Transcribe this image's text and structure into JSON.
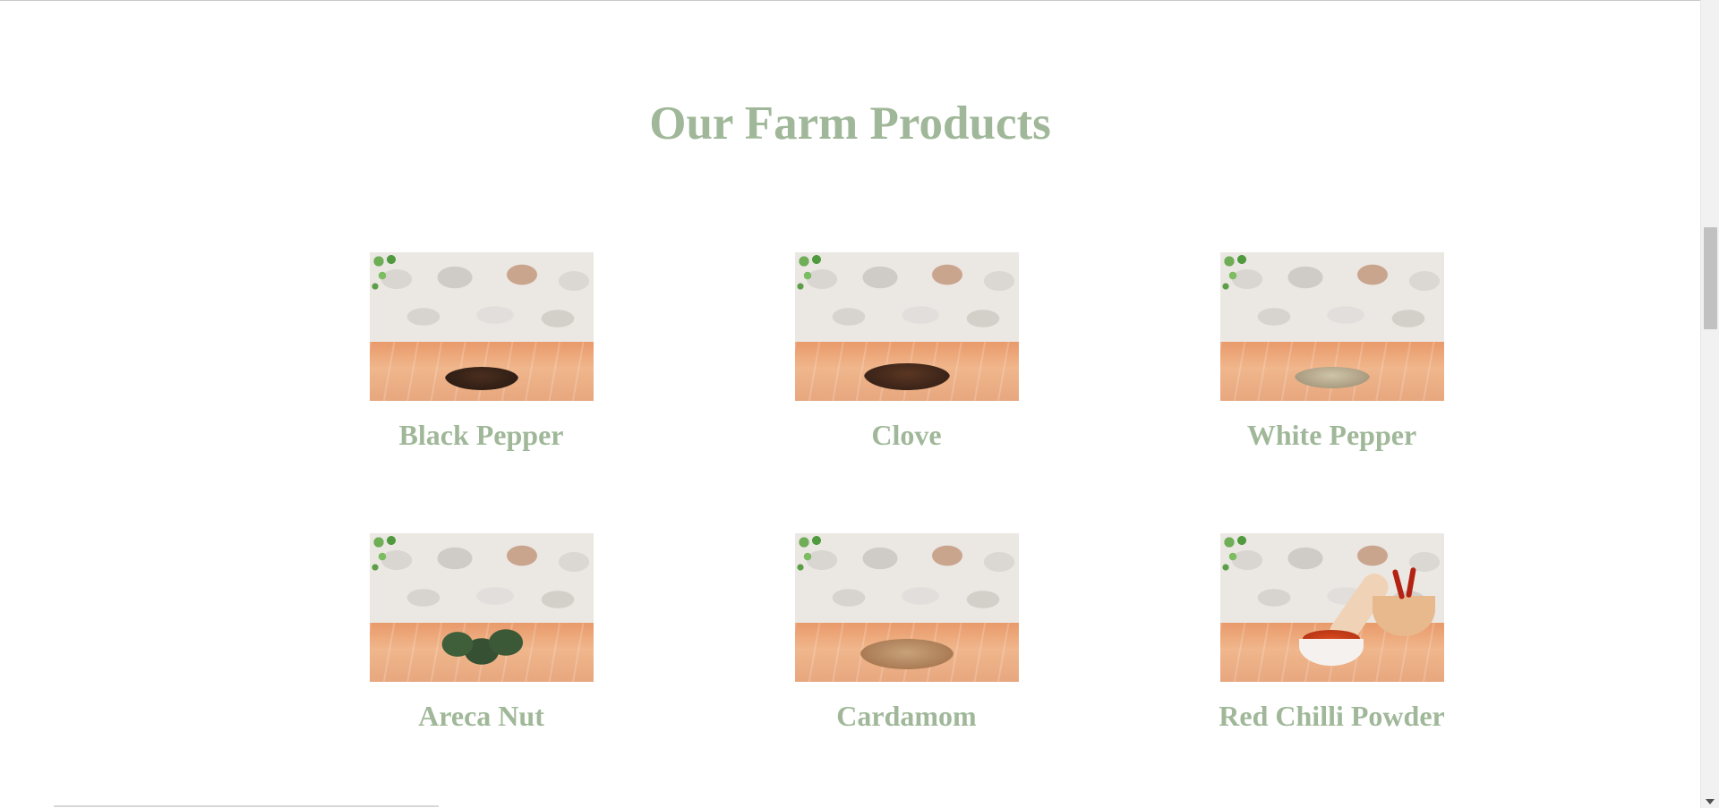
{
  "section": {
    "title": "Our Farm Products"
  },
  "products": [
    {
      "name": "Black Pepper",
      "image_icon": "black-pepper-image"
    },
    {
      "name": "Clove",
      "image_icon": "clove-image"
    },
    {
      "name": "White Pepper",
      "image_icon": "white-pepper-image"
    },
    {
      "name": "Areca Nut",
      "image_icon": "areca-nut-image"
    },
    {
      "name": "Cardamom",
      "image_icon": "cardamom-image"
    },
    {
      "name": "Red Chilli Powder",
      "image_icon": "red-chilli-powder-image"
    }
  ],
  "colors": {
    "heading": "#a0b899",
    "background": "#ffffff"
  }
}
